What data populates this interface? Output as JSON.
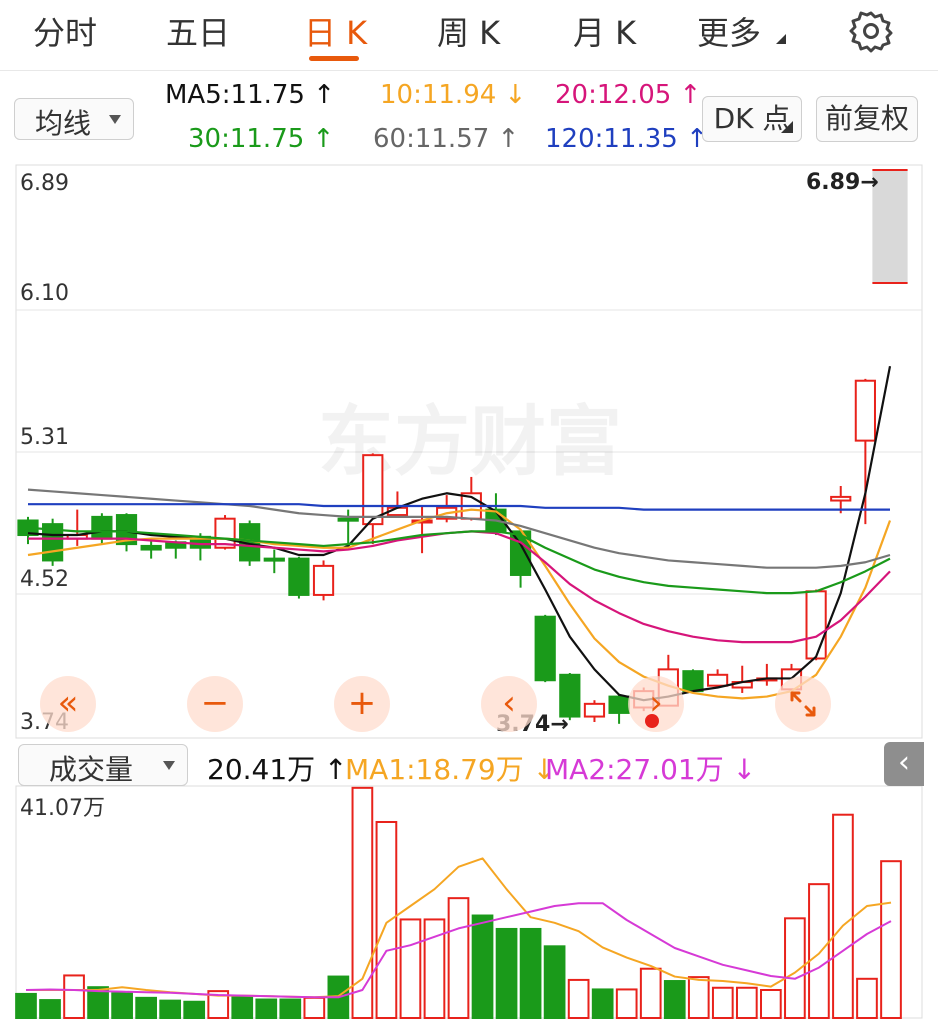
{
  "tabs": [
    {
      "label": "分时",
      "active": false
    },
    {
      "label": "五日",
      "active": false
    },
    {
      "label": "日 K",
      "active": true
    },
    {
      "label": "周 K",
      "active": false
    },
    {
      "label": "月 K",
      "active": false
    },
    {
      "label": "更多",
      "active": false
    }
  ],
  "indicator_select": {
    "value": "均线"
  },
  "ma_legend": [
    {
      "text": "MA5:11.75 ↑",
      "color": "#111111"
    },
    {
      "text": "10:11.94 ↓",
      "color": "#f5a623"
    },
    {
      "text": "20:12.05 ↑",
      "color": "#d6157a"
    },
    {
      "text": "30:11.75 ↑",
      "color": "#1a9a1a"
    },
    {
      "text": "60:11.57 ↑",
      "color": "#666666"
    },
    {
      "text": "120:11.35 ↑",
      "color": "#1f3fbf"
    }
  ],
  "buttons": {
    "dk_point": "DK 点",
    "adjust": "前复权"
  },
  "price_labels": {
    "top": "6.89",
    "p2": "6.10",
    "p3": "5.31",
    "p4": "4.52",
    "bottom": "3.74"
  },
  "markers": {
    "high": "6.89→",
    "low": "3.74→"
  },
  "watermark": "东方财富",
  "volume_select": {
    "value": "成交量"
  },
  "volume_legend": [
    {
      "text": "20.41万 ↑",
      "color": "#111111"
    },
    {
      "text": "MA1:18.79万 ↓",
      "color": "#f5a623"
    },
    {
      "text": "MA2:27.01万 ↓",
      "color": "#d63ad6"
    }
  ],
  "volume_max_label": "41.07万",
  "colors": {
    "up": "#e8221b",
    "down": "#1a9a1a",
    "accent": "#e8590c",
    "ma5": "#111111",
    "ma10": "#f5a623",
    "ma20": "#d6157a",
    "ma30": "#1a9a1a",
    "ma60": "#777777",
    "ma120": "#1f3fbf",
    "vma1": "#f5a623",
    "vma2": "#d63ad6"
  },
  "chart_data": {
    "type": "candlestick",
    "y_range": [
      3.74,
      6.89
    ],
    "candles": [
      {
        "o": 4.85,
        "c": 4.77,
        "h": 4.87,
        "l": 4.72
      },
      {
        "o": 4.83,
        "c": 4.63,
        "h": 4.86,
        "l": 4.6
      },
      {
        "o": 4.75,
        "c": 4.77,
        "h": 4.91,
        "l": 4.71
      },
      {
        "o": 4.87,
        "c": 4.75,
        "h": 4.89,
        "l": 4.72
      },
      {
        "o": 4.88,
        "c": 4.72,
        "h": 4.89,
        "l": 4.68
      },
      {
        "o": 4.71,
        "c": 4.69,
        "h": 4.75,
        "l": 4.64
      },
      {
        "o": 4.73,
        "c": 4.7,
        "h": 4.74,
        "l": 4.64
      },
      {
        "o": 4.76,
        "c": 4.7,
        "h": 4.78,
        "l": 4.63
      },
      {
        "o": 4.7,
        "c": 4.86,
        "h": 4.88,
        "l": 4.69
      },
      {
        "o": 4.83,
        "c": 4.63,
        "h": 4.85,
        "l": 4.6
      },
      {
        "o": 4.64,
        "c": 4.63,
        "h": 4.69,
        "l": 4.56
      },
      {
        "o": 4.64,
        "c": 4.44,
        "h": 4.65,
        "l": 4.42
      },
      {
        "o": 4.44,
        "c": 4.6,
        "h": 4.63,
        "l": 4.41
      },
      {
        "o": 4.86,
        "c": 4.85,
        "h": 4.91,
        "l": 4.72
      },
      {
        "o": 4.83,
        "c": 5.21,
        "h": 5.22,
        "l": 4.72
      },
      {
        "o": 4.88,
        "c": 4.92,
        "h": 5.01,
        "l": 4.87
      },
      {
        "o": 4.84,
        "c": 4.85,
        "h": 4.93,
        "l": 4.67
      },
      {
        "o": 4.86,
        "c": 4.92,
        "h": 4.99,
        "l": 4.84
      },
      {
        "o": 4.86,
        "c": 5.0,
        "h": 5.09,
        "l": 4.85
      },
      {
        "o": 4.91,
        "c": 4.79,
        "h": 5.0,
        "l": 4.77
      },
      {
        "o": 4.79,
        "c": 4.55,
        "h": 4.8,
        "l": 4.48
      },
      {
        "o": 4.32,
        "c": 3.97,
        "h": 4.33,
        "l": 3.96
      },
      {
        "o": 4.0,
        "c": 3.77,
        "h": 4.01,
        "l": 3.75
      },
      {
        "o": 3.77,
        "c": 3.84,
        "h": 3.86,
        "l": 3.74
      },
      {
        "o": 3.88,
        "c": 3.79,
        "h": 3.89,
        "l": 3.73
      },
      {
        "o": 3.82,
        "c": 3.91,
        "h": 3.93,
        "l": 3.8
      },
      {
        "o": 3.83,
        "c": 4.03,
        "h": 4.11,
        "l": 3.83
      },
      {
        "o": 4.02,
        "c": 3.91,
        "h": 4.03,
        "l": 3.9
      },
      {
        "o": 3.94,
        "c": 4.0,
        "h": 4.03,
        "l": 3.93
      },
      {
        "o": 3.93,
        "c": 3.96,
        "h": 4.05,
        "l": 3.9
      },
      {
        "o": 3.97,
        "c": 3.98,
        "h": 4.06,
        "l": 3.94
      },
      {
        "o": 3.92,
        "c": 4.03,
        "h": 4.06,
        "l": 3.91
      },
      {
        "o": 4.09,
        "c": 4.46,
        "h": 4.47,
        "l": 4.08
      },
      {
        "o": 4.96,
        "c": 4.98,
        "h": 5.04,
        "l": 4.89
      },
      {
        "o": 5.29,
        "c": 5.62,
        "h": 5.63,
        "l": 4.83
      },
      {
        "o": 6.1,
        "c": 6.89,
        "h": 6.89,
        "l": 6.1
      }
    ],
    "ma": {
      "MA5": [
        4.78,
        4.77,
        4.77,
        4.79,
        4.79,
        4.77,
        4.76,
        4.75,
        4.75,
        4.72,
        4.7,
        4.66,
        4.66,
        4.71,
        4.86,
        4.92,
        4.97,
        5.0,
        4.98,
        4.9,
        4.72,
        4.47,
        4.21,
        4.03,
        3.89,
        3.86,
        3.88,
        3.91,
        3.93,
        3.96,
        3.98,
        3.98,
        4.1,
        4.45,
        5.0,
        5.7
      ],
      "MA10": [
        4.66,
        4.68,
        4.7,
        4.72,
        4.74,
        4.75,
        4.75,
        4.75,
        4.75,
        4.74,
        4.72,
        4.71,
        4.7,
        4.7,
        4.75,
        4.8,
        4.85,
        4.89,
        4.91,
        4.9,
        4.8,
        4.6,
        4.39,
        4.2,
        4.07,
        3.99,
        3.94,
        3.9,
        3.88,
        3.87,
        3.88,
        3.91,
        4.0,
        4.21,
        4.48,
        4.85
      ],
      "MA20": [
        4.75,
        4.75,
        4.75,
        4.75,
        4.75,
        4.74,
        4.73,
        4.72,
        4.72,
        4.71,
        4.7,
        4.69,
        4.68,
        4.69,
        4.71,
        4.74,
        4.76,
        4.78,
        4.79,
        4.78,
        4.73,
        4.62,
        4.5,
        4.41,
        4.34,
        4.28,
        4.24,
        4.21,
        4.19,
        4.18,
        4.18,
        4.18,
        4.21,
        4.3,
        4.43,
        4.57
      ],
      "MA30": [
        4.81,
        4.8,
        4.79,
        4.79,
        4.79,
        4.78,
        4.77,
        4.76,
        4.75,
        4.74,
        4.73,
        4.72,
        4.71,
        4.72,
        4.73,
        4.75,
        4.77,
        4.78,
        4.79,
        4.79,
        4.77,
        4.7,
        4.64,
        4.58,
        4.54,
        4.51,
        4.49,
        4.48,
        4.47,
        4.46,
        4.45,
        4.45,
        4.46,
        4.51,
        4.57,
        4.64
      ],
      "MA60": [
        5.02,
        5.01,
        5.0,
        4.99,
        4.98,
        4.97,
        4.96,
        4.95,
        4.94,
        4.93,
        4.91,
        4.89,
        4.88,
        4.87,
        4.87,
        4.87,
        4.87,
        4.87,
        4.86,
        4.85,
        4.82,
        4.78,
        4.74,
        4.7,
        4.67,
        4.65,
        4.63,
        4.62,
        4.61,
        4.6,
        4.59,
        4.59,
        4.59,
        4.6,
        4.62,
        4.66
      ],
      "MA120": [
        4.94,
        4.94,
        4.94,
        4.94,
        4.94,
        4.94,
        4.94,
        4.94,
        4.94,
        4.94,
        4.94,
        4.94,
        4.93,
        4.93,
        4.93,
        4.93,
        4.93,
        4.93,
        4.93,
        4.93,
        4.93,
        4.92,
        4.92,
        4.92,
        4.92,
        4.91,
        4.91,
        4.91,
        4.91,
        4.91,
        4.91,
        4.91,
        4.91,
        4.91,
        4.91,
        4.91
      ]
    },
    "volume": {
      "max": 41.07,
      "values": [
        4.3,
        3.2,
        7.6,
        5.5,
        4.4,
        3.6,
        3.1,
        2.9,
        4.8,
        3.7,
        3.3,
        3.3,
        3.6,
        7.4,
        41.1,
        35.0,
        17.6,
        17.6,
        21.4,
        18.3,
        15.9,
        15.9,
        12.8,
        6.8,
        5.1,
        5.1,
        8.8,
        6.6,
        7.3,
        5.4,
        5.4,
        5.0,
        17.8,
        23.9,
        36.3,
        7.0,
        28.0
      ],
      "ma1": [
        5.0,
        5.0,
        5.0,
        5.0,
        5.5,
        5.0,
        4.6,
        4.3,
        4.0,
        4.0,
        3.9,
        3.8,
        3.7,
        3.9,
        7.0,
        17.0,
        20.0,
        23.0,
        27.0,
        28.5,
        23.0,
        18.0,
        17.0,
        15.5,
        12.6,
        10.8,
        9.3,
        7.4,
        6.8,
        6.6,
        6.2,
        5.6,
        8.1,
        11.5,
        16.5,
        20.0,
        20.6
      ],
      "ma2": [
        5.0,
        5.1,
        5.0,
        4.8,
        4.7,
        4.6,
        4.5,
        4.3,
        4.1,
        4.0,
        3.9,
        3.8,
        3.7,
        3.7,
        5.0,
        12.0,
        13.0,
        14.5,
        16.0,
        17.0,
        18.0,
        19.0,
        20.0,
        20.5,
        20.5,
        17.5,
        15.0,
        12.5,
        11.0,
        9.5,
        8.5,
        7.5,
        7.0,
        9.0,
        12.0,
        15.0,
        17.3
      ]
    }
  }
}
